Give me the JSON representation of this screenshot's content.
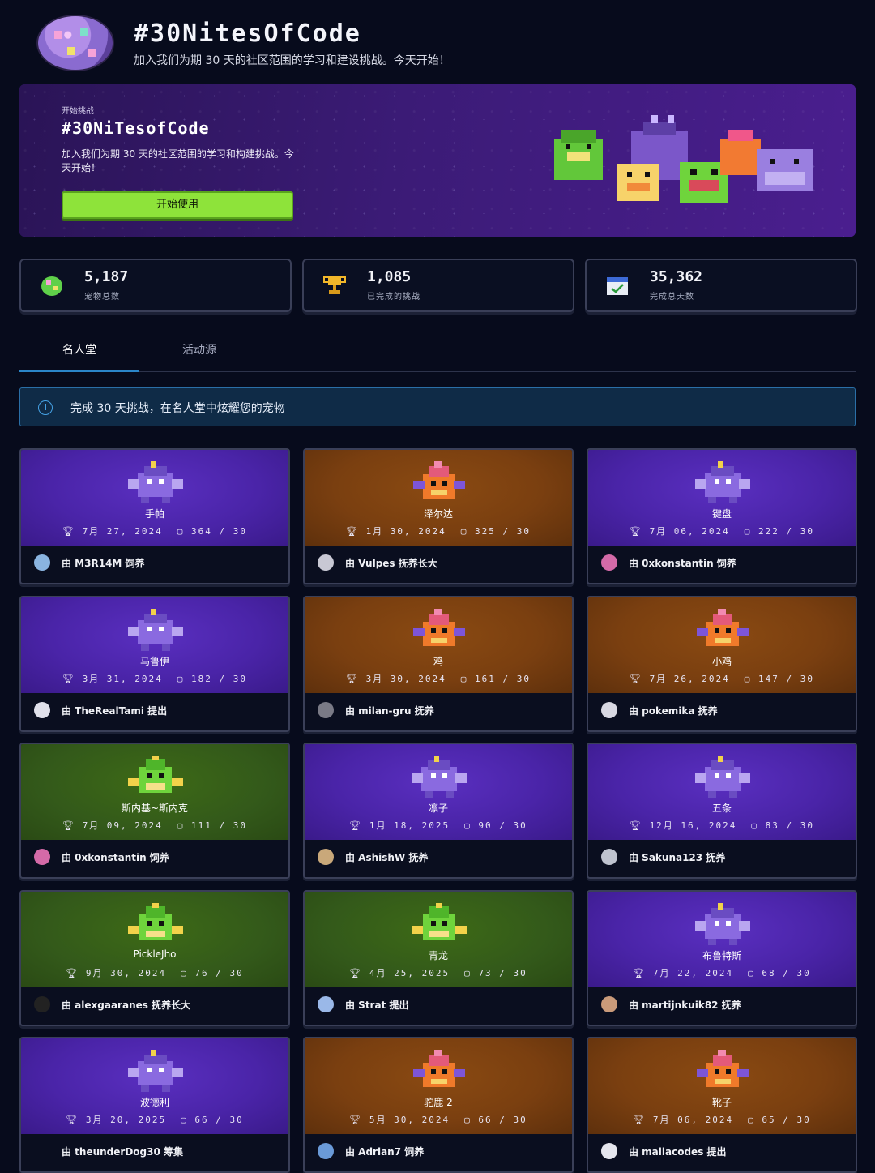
{
  "header": {
    "title": "#30NitesOfCode",
    "subtitle": "加入我们为期 30 天的社区范围的学习和建设挑战。今天开始！"
  },
  "hero": {
    "kicker": "开始挑战",
    "title": "#30NiTesofCode",
    "description": "加入我们为期 30 天的社区范围的学习和构建挑战。今天开始！",
    "button_label": "开始使用"
  },
  "stats": [
    {
      "value": "5,187",
      "label": "宠物总数",
      "icon": "egg-icon"
    },
    {
      "value": "1,085",
      "label": "已完成的挑战",
      "icon": "trophy-icon"
    },
    {
      "value": "35,362",
      "label": "完成总天数",
      "icon": "calendar-check-icon"
    }
  ],
  "tabs": {
    "active": "名人堂",
    "inactive": "活动源"
  },
  "info_banner": "完成 30 天挑战，在名人堂中炫耀您的宠物",
  "colors": {
    "purple": "#4a24a8",
    "orange": "#7a3f10",
    "green": "#33591a",
    "accent_green": "#8ee33a",
    "info_blue": "#2a6fa7"
  },
  "cards": [
    {
      "theme": "purple",
      "pet": "dragon-purple",
      "name": "手帕",
      "date": "7月 27, 2024",
      "days": "364 / 30",
      "owner": "由 M3R14M 饲养"
    },
    {
      "theme": "orange",
      "pet": "dragon-orange",
      "name": "泽尔达",
      "date": "1月 30, 2024",
      "days": "325 / 30",
      "owner": "由 Vulpes 抚养长大"
    },
    {
      "theme": "purple",
      "pet": "dragon-purple",
      "name": "键盘",
      "date": "7月 06, 2024",
      "days": "222 / 30",
      "owner": "由 0xkonstantin 饲养"
    },
    {
      "theme": "purple",
      "pet": "dragon-purple",
      "name": "马鲁伊",
      "date": "3月 31, 2024",
      "days": "182 / 30",
      "owner": "由 TheRealTami 提出"
    },
    {
      "theme": "orange",
      "pet": "dragon-orange",
      "name": "鸡",
      "date": "3月 30, 2024",
      "days": "161 / 30",
      "owner": "由 milan-gru 抚养"
    },
    {
      "theme": "orange",
      "pet": "dragon-orange",
      "name": "小鸡",
      "date": "7月 26, 2024",
      "days": "147 / 30",
      "owner": "由 pokemika 抚养"
    },
    {
      "theme": "green",
      "pet": "dragon-green",
      "name": "斯内基~斯内克",
      "date": "7月 09, 2024",
      "days": "111 / 30",
      "owner": "由 0xkonstantin 饲养"
    },
    {
      "theme": "purple",
      "pet": "dragon-purple",
      "name": "凛子",
      "date": "1月 18, 2025",
      "days": "90 / 30",
      "owner": "由 AshishW 抚养"
    },
    {
      "theme": "purple",
      "pet": "dragon-purple",
      "name": "五条",
      "date": "12月 16, 2024",
      "days": "83 / 30",
      "owner": "由 Sakuna123 抚养"
    },
    {
      "theme": "green",
      "pet": "dragon-green",
      "name": "PickleJho",
      "date": "9月 30, 2024",
      "days": "76 / 30",
      "owner": "由 alexgaaranes 抚养长大"
    },
    {
      "theme": "green",
      "pet": "dragon-green",
      "name": "青龙",
      "date": "4月 25, 2025",
      "days": "73 / 30",
      "owner": "由 Strat 提出"
    },
    {
      "theme": "purple",
      "pet": "dragon-purple",
      "name": "布鲁特斯",
      "date": "7月 22, 2024",
      "days": "68 / 30",
      "owner": "由 martijnkuik82 抚养"
    },
    {
      "theme": "purple",
      "pet": "dragon-purple",
      "name": "波德利",
      "date": "3月 20, 2025",
      "days": "66 / 30",
      "owner": "由 theunderDog30 筹集"
    },
    {
      "theme": "orange",
      "pet": "dragon-orange",
      "name": "驼鹿 2",
      "date": "5月 30, 2024",
      "days": "66 / 30",
      "owner": "由 Adrian7 饲养"
    },
    {
      "theme": "orange",
      "pet": "dragon-orange",
      "name": "靴子",
      "date": "7月 06, 2024",
      "days": "65 / 30",
      "owner": "由 maliacodes 提出"
    }
  ]
}
